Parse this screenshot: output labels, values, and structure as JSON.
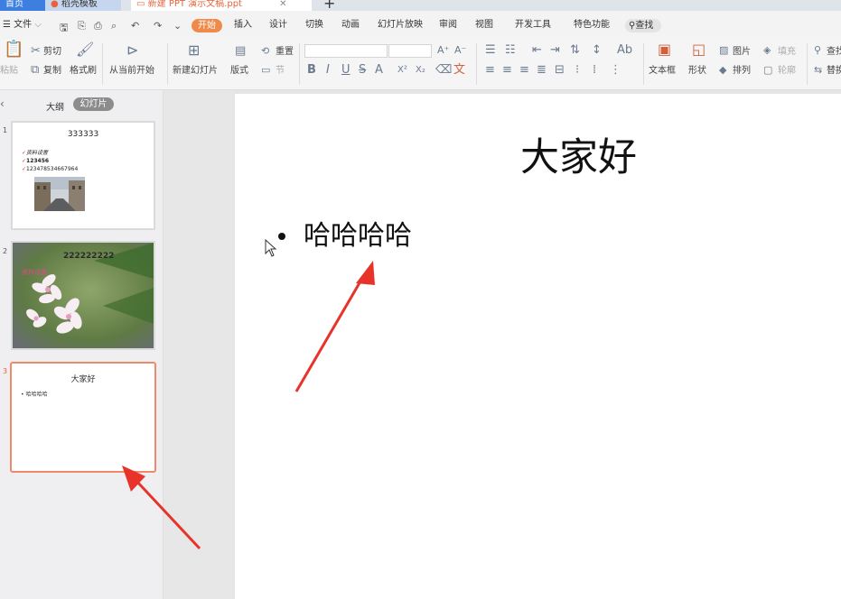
{
  "tabs": {
    "home": "首页",
    "template": "稻壳模板",
    "doc": "新建 PPT 演示文稿.ppt",
    "new_tab": "+"
  },
  "menu": {
    "file": "文件",
    "items": [
      "开始",
      "插入",
      "设计",
      "切换",
      "动画",
      "幻灯片放映",
      "审阅",
      "视图",
      "开发工具",
      "特色功能"
    ],
    "search": "查找"
  },
  "ribbon": {
    "paste": "粘贴",
    "cut": "剪切",
    "copy": "复制",
    "format_painter": "格式刷",
    "from_current": "从当前开始",
    "new_slide": "新建幻灯片",
    "layout": "版式",
    "reset": "重置",
    "section": "节",
    "textbox": "文本框",
    "shape": "形状",
    "picture": "图片",
    "fill": "填充",
    "arrange": "排列",
    "outline": "轮廓",
    "find": "查找",
    "replace": "替换",
    "bold": "B",
    "italic": "I",
    "underline": "U",
    "strike": "S"
  },
  "panel": {
    "outline_tab": "大纲",
    "slides_tab": "幻灯片",
    "slides": [
      {
        "number": "1",
        "title": "333333",
        "lines": [
          "资料设置",
          "123456",
          "123478534667964"
        ]
      },
      {
        "number": "2",
        "title": "222222222",
        "subtitle": "资料设置"
      },
      {
        "number": "3",
        "title": "大家好",
        "lines": [
          "哈哈哈哈"
        ]
      }
    ]
  },
  "slide": {
    "title": "大家好",
    "body": "哈哈哈哈"
  },
  "colors": {
    "accent": "#f08a4b",
    "selection": "#ee8a6a",
    "arrow": "#e8332a"
  }
}
